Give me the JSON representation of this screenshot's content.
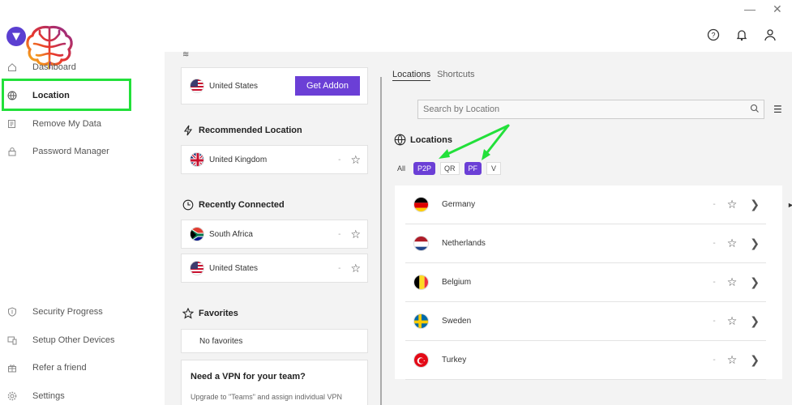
{
  "window": {
    "minimize_icon": "minimize-icon",
    "close_icon": "close-icon"
  },
  "header": {
    "icons": [
      "help-icon",
      "bell-icon",
      "user-icon"
    ]
  },
  "sidebar": {
    "items": [
      {
        "label": "Dashboard",
        "icon": "home-icon"
      },
      {
        "label": "Location",
        "icon": "globe-icon"
      },
      {
        "label": "Remove My Data",
        "icon": "data-icon"
      },
      {
        "label": "Password Manager",
        "icon": "lock-icon"
      },
      {
        "label": "Security Progress",
        "icon": "shield-icon"
      },
      {
        "label": "Setup Other Devices",
        "icon": "devices-icon"
      },
      {
        "label": "Refer a friend",
        "icon": "gift-icon"
      },
      {
        "label": "Settings",
        "icon": "gear-icon"
      }
    ],
    "active": "Location"
  },
  "middle": {
    "addon_card": {
      "country": "United States",
      "button": "Get Addon"
    },
    "recommended": {
      "title": "Recommended Location",
      "items": [
        {
          "country": "United Kingdom",
          "latency": "-"
        }
      ]
    },
    "recent": {
      "title": "Recently Connected",
      "items": [
        {
          "country": "South Africa",
          "latency": "-"
        },
        {
          "country": "United States",
          "latency": "-"
        }
      ]
    },
    "favorites": {
      "title": "Favorites",
      "empty": "No favorites"
    },
    "teams": {
      "title": "Need a VPN for your team?",
      "desc": "Upgrade to \"Teams\" and assign individual VPN"
    }
  },
  "right": {
    "tabs": [
      "Locations",
      "Shortcuts"
    ],
    "active_tab": "Locations",
    "search_placeholder": "Search by Location",
    "section_title": "Locations",
    "filters": [
      {
        "label": "All",
        "active": false
      },
      {
        "label": "P2P",
        "active": true
      },
      {
        "label": "QR",
        "active": false
      },
      {
        "label": "PF",
        "active": true
      },
      {
        "label": "V",
        "active": false
      }
    ],
    "countries": [
      {
        "name": "Germany",
        "latency": "-"
      },
      {
        "name": "Netherlands",
        "latency": "-"
      },
      {
        "name": "Belgium",
        "latency": "-"
      },
      {
        "name": "Sweden",
        "latency": "-"
      },
      {
        "name": "Turkey",
        "latency": "-"
      }
    ]
  },
  "colors": {
    "accent": "#6b3fd6",
    "highlight": "#22e03a"
  }
}
